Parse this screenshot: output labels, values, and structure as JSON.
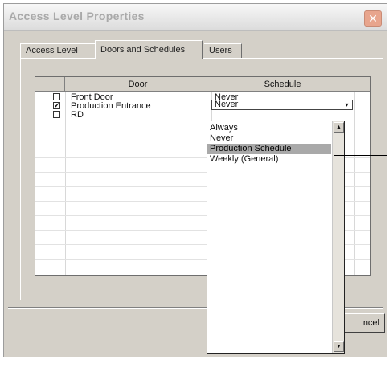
{
  "window": {
    "title": "Access Level Properties"
  },
  "tabs": [
    {
      "label": "Access Level"
    },
    {
      "label": "Doors and Schedules"
    },
    {
      "label": "Users"
    }
  ],
  "grid": {
    "columns": [
      {
        "label": ""
      },
      {
        "label": "Door"
      },
      {
        "label": "Schedule"
      }
    ],
    "rows": [
      {
        "checked": false,
        "door": "Front Door",
        "schedule": "Never"
      },
      {
        "checked": true,
        "door": "Production Entrance",
        "schedule": "Never"
      },
      {
        "checked": false,
        "door": "RD",
        "schedule": ""
      }
    ]
  },
  "schedule_dropdown": {
    "current_value": "Never",
    "options": [
      "Always",
      "Never",
      "Production Schedule",
      "Weekly (General)"
    ],
    "highlighted": "Production Schedule"
  },
  "buttons": {
    "cancel_partial": "ncel"
  },
  "glyphs": {
    "check": "✔",
    "combo_arrow": "▾",
    "scroll_up": "▲",
    "scroll_down": "▼"
  }
}
